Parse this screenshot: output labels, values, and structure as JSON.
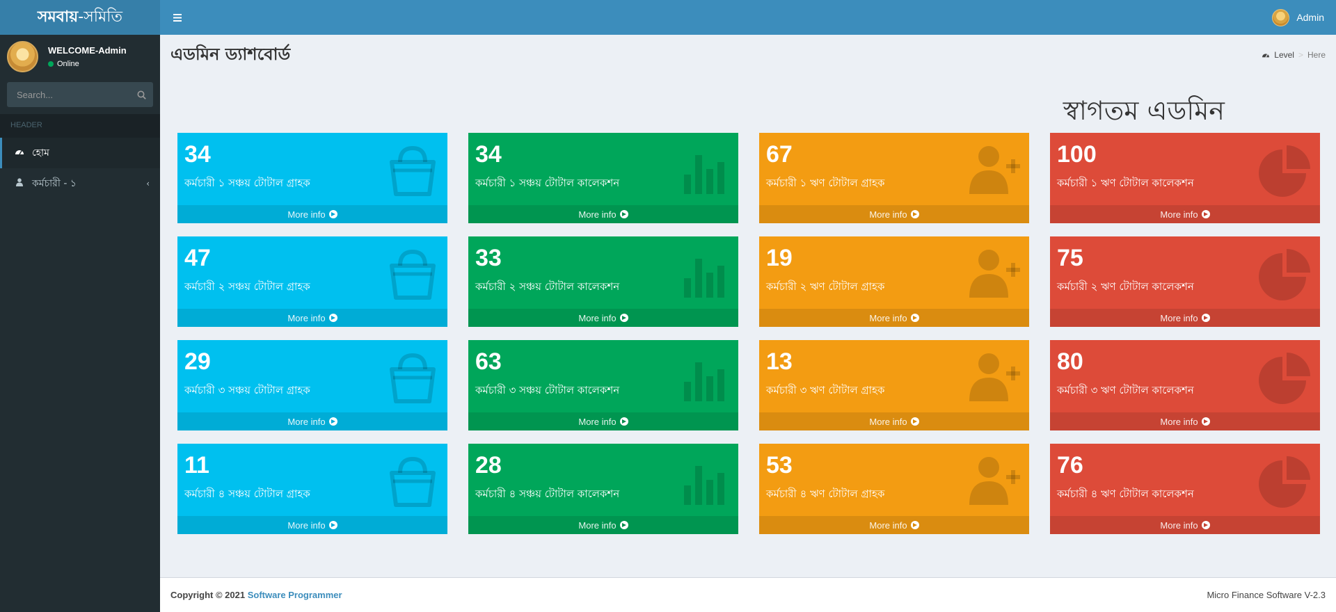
{
  "app": {
    "logo_bold": "সমবায়",
    "logo_rest": "-সমিতি",
    "user_label": "Admin"
  },
  "sidebar": {
    "welcome": "WELCOME-Admin",
    "status": "Online",
    "search_placeholder": "Search...",
    "header_label": "HEADER",
    "items": [
      {
        "label": "হোম",
        "icon": "dashboard-icon"
      },
      {
        "label": "কর্মচারী - ১",
        "icon": "user-icon"
      }
    ]
  },
  "page": {
    "title": "এডমিন ড্যাশবোর্ড",
    "breadcrumb_level": "Level",
    "breadcrumb_sep": ">",
    "breadcrumb_here": "Here",
    "welcome": "স্বাগতম এডমিন",
    "more_info": "More info"
  },
  "boxes": [
    {
      "value": "34",
      "label": "কর্মচারী ১ সঞ্চয় টোটাল গ্রাহক",
      "color": "aqua",
      "icon": "shopping-bag-icon"
    },
    {
      "value": "34",
      "label": "কর্মচারী ১ সঞ্চয় টোটাল কালেকশন",
      "color": "green",
      "icon": "bar-chart-icon"
    },
    {
      "value": "67",
      "label": "কর্মচারী ১ ঋণ টোটাল গ্রাহক",
      "color": "yellow",
      "icon": "user-add-icon"
    },
    {
      "value": "100",
      "label": "কর্মচারী ১ ঋণ টোটাল কালেকশন",
      "color": "red",
      "icon": "pie-chart-icon"
    },
    {
      "value": "47",
      "label": "কর্মচারী ২ সঞ্চয় টোটাল গ্রাহক",
      "color": "aqua",
      "icon": "shopping-bag-icon"
    },
    {
      "value": "33",
      "label": "কর্মচারী ২ সঞ্চয় টোটাল কালেকশন",
      "color": "green",
      "icon": "bar-chart-icon"
    },
    {
      "value": "19",
      "label": "কর্মচারী ২ ঋণ টোটাল গ্রাহক",
      "color": "yellow",
      "icon": "user-add-icon"
    },
    {
      "value": "75",
      "label": "কর্মচারী ২ ঋণ টোটাল কালেকশন",
      "color": "red",
      "icon": "pie-chart-icon"
    },
    {
      "value": "29",
      "label": "কর্মচারী ৩ সঞ্চয় টোটাল গ্রাহক",
      "color": "aqua",
      "icon": "shopping-bag-icon"
    },
    {
      "value": "63",
      "label": "কর্মচারী ৩ সঞ্চয় টোটাল কালেকশন",
      "color": "green",
      "icon": "bar-chart-icon"
    },
    {
      "value": "13",
      "label": "কর্মচারী ৩ ঋণ টোটাল গ্রাহক",
      "color": "yellow",
      "icon": "user-add-icon"
    },
    {
      "value": "80",
      "label": "কর্মচারী ৩ ঋণ টোটাল কালেকশন",
      "color": "red",
      "icon": "pie-chart-icon"
    },
    {
      "value": "11",
      "label": "কর্মচারী ৪ সঞ্চয় টোটাল গ্রাহক",
      "color": "aqua",
      "icon": "shopping-bag-icon"
    },
    {
      "value": "28",
      "label": "কর্মচারী ৪ সঞ্চয় টোটাল কালেকশন",
      "color": "green",
      "icon": "bar-chart-icon"
    },
    {
      "value": "53",
      "label": "কর্মচারী ৪ ঋণ টোটাল গ্রাহক",
      "color": "yellow",
      "icon": "user-add-icon"
    },
    {
      "value": "76",
      "label": "কর্মচারী ৪ ঋণ টোটাল কালেকশন",
      "color": "red",
      "icon": "pie-chart-icon"
    }
  ],
  "footer": {
    "copyright": "Copyright © 2021",
    "company": "Software Programmer",
    "version": "Micro Finance Software V-2.3"
  },
  "colors": {
    "aqua": "#00c0ef",
    "green": "#00a65a",
    "yellow": "#f39c12",
    "red": "#dd4b39",
    "header": "#3c8dbc",
    "sidebar": "#222d32"
  }
}
